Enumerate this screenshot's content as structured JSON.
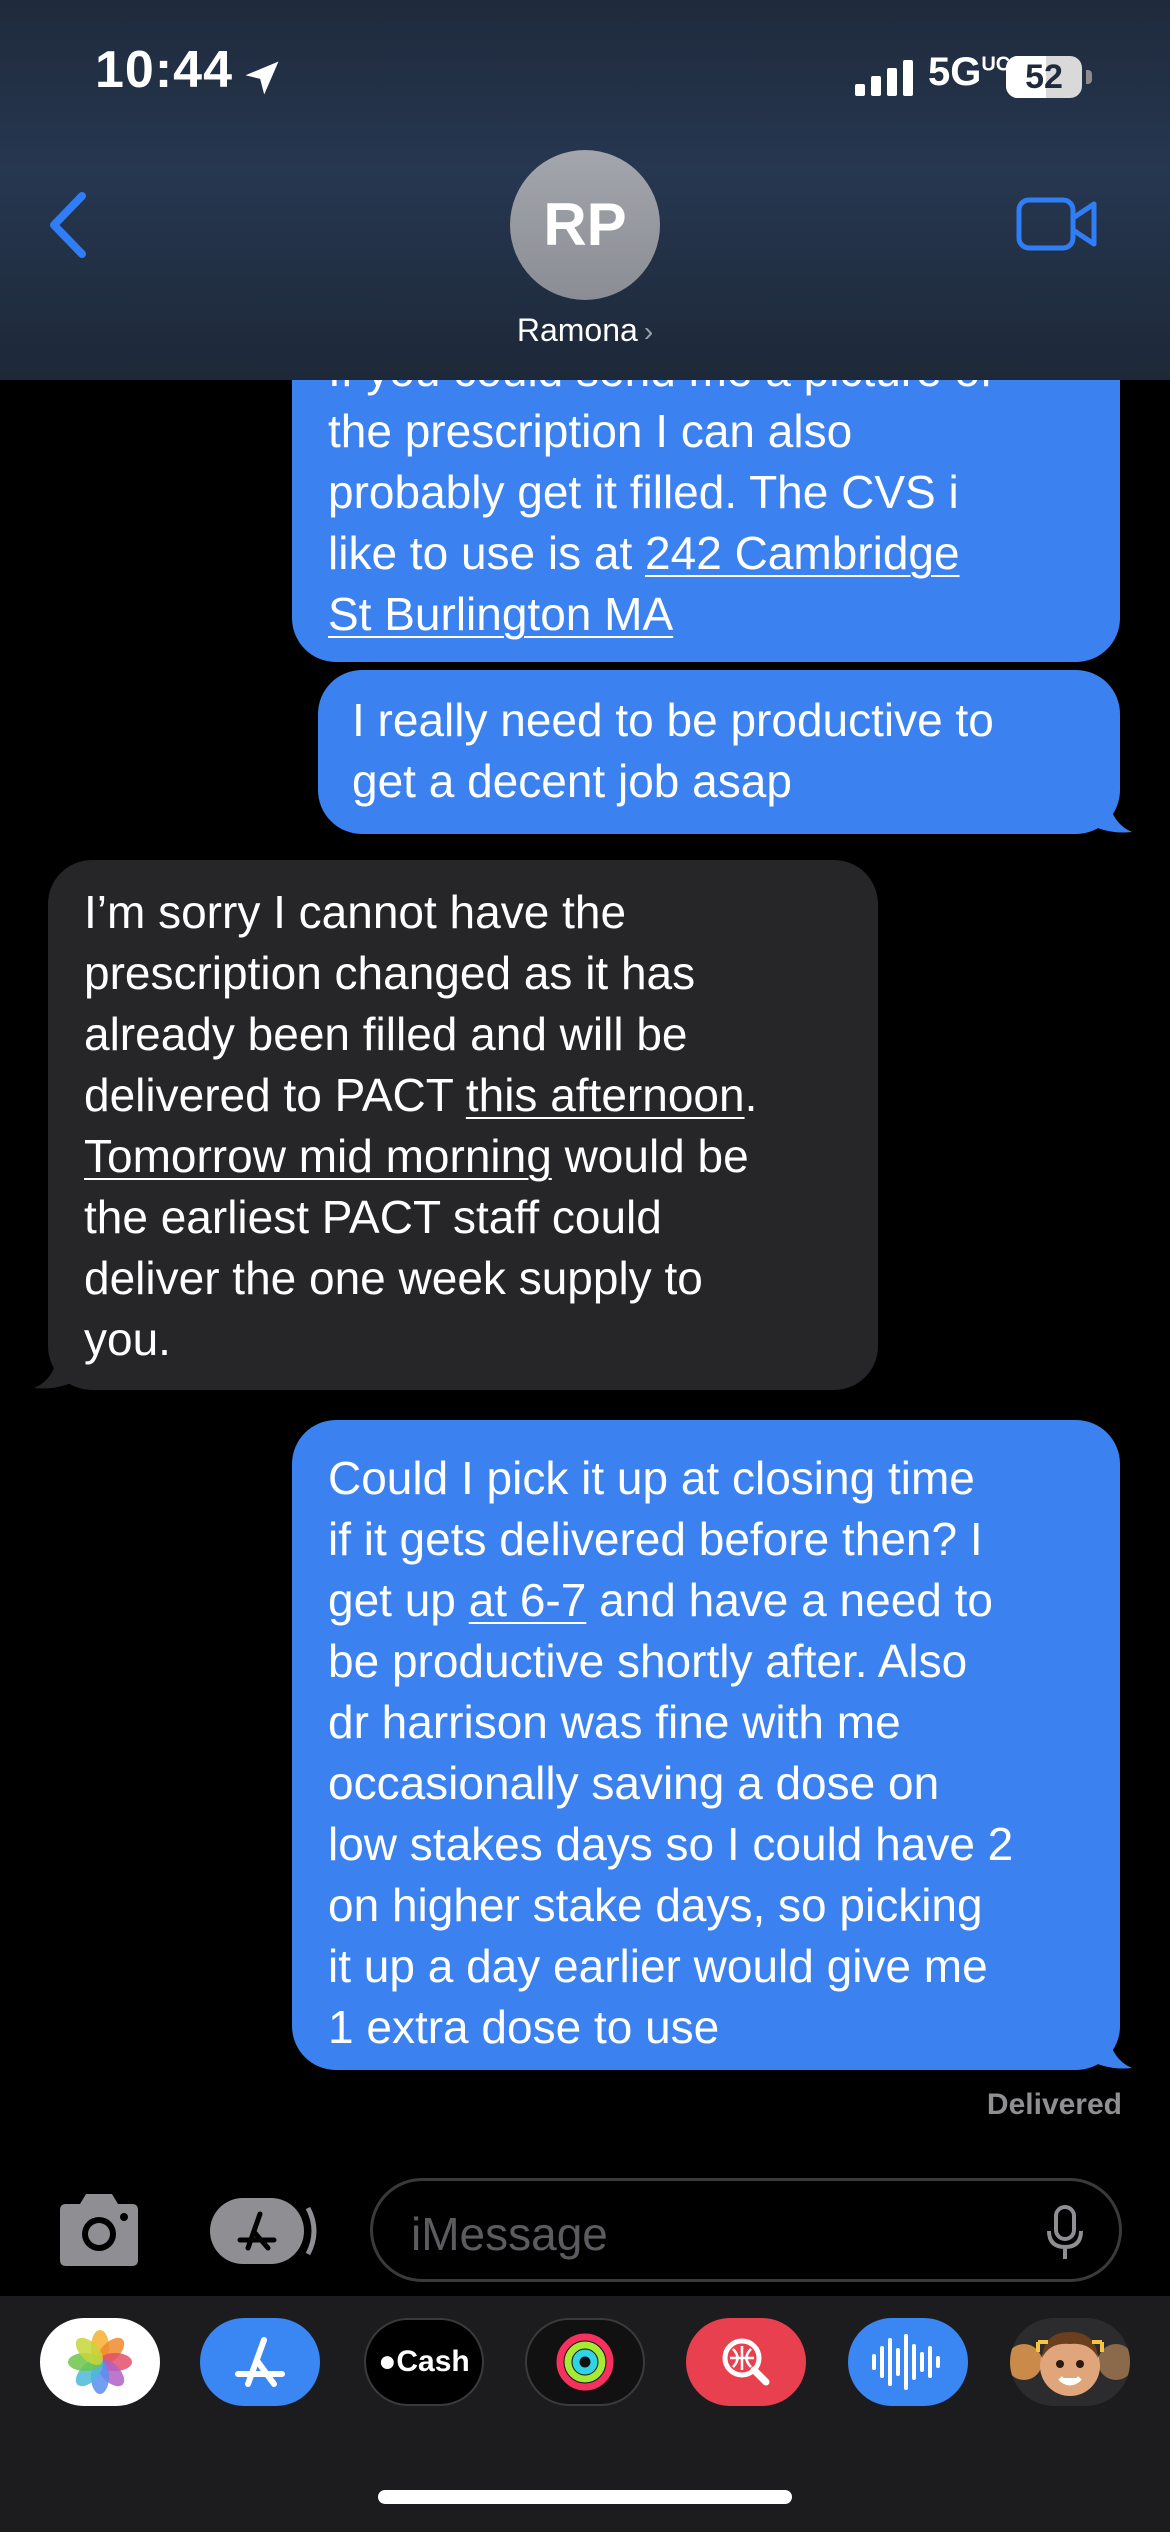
{
  "status_bar": {
    "time": "10:44",
    "network": "5G",
    "network_sup": "UC",
    "battery": "52"
  },
  "header": {
    "avatar_initials": "RP",
    "contact_name": "Ramona"
  },
  "messages": [
    {
      "from": "me",
      "lines": [
        "the prescription I can also",
        "probably get it filled. The CVS i",
        "like to use is at ",
        "242 Cambridge",
        "St Burlington MA"
      ],
      "partial_top_line": "If you could send me a picture of"
    },
    {
      "from": "me",
      "lines": [
        "I really need to be productive to",
        "get a decent job asap"
      ]
    },
    {
      "from": "them",
      "lines": [
        "I’m sorry I cannot have the",
        "prescription changed as it has",
        "already been filled and will be",
        "delivered to PACT ",
        "this afternoon",
        ".",
        "Tomorrow mid morning",
        " would be",
        "the earliest PACT staff could",
        "deliver the one week supply to",
        "you."
      ]
    },
    {
      "from": "me",
      "lines": [
        "Could I pick it up at closing time",
        "if it gets delivered before then? I",
        "get up ",
        "at 6-7",
        " and have a need to",
        "be productive shortly after. Also",
        "dr harrison was fine with me",
        "occasionally saving a dose on",
        "low stakes days so I could have 2",
        "on higher stake days, so picking",
        "it up a day earlier would give me",
        "1 extra dose to use"
      ]
    }
  ],
  "delivered_label": "Delivered",
  "composer": {
    "placeholder": "iMessage"
  },
  "apps": {
    "cash_label": "Cash"
  }
}
